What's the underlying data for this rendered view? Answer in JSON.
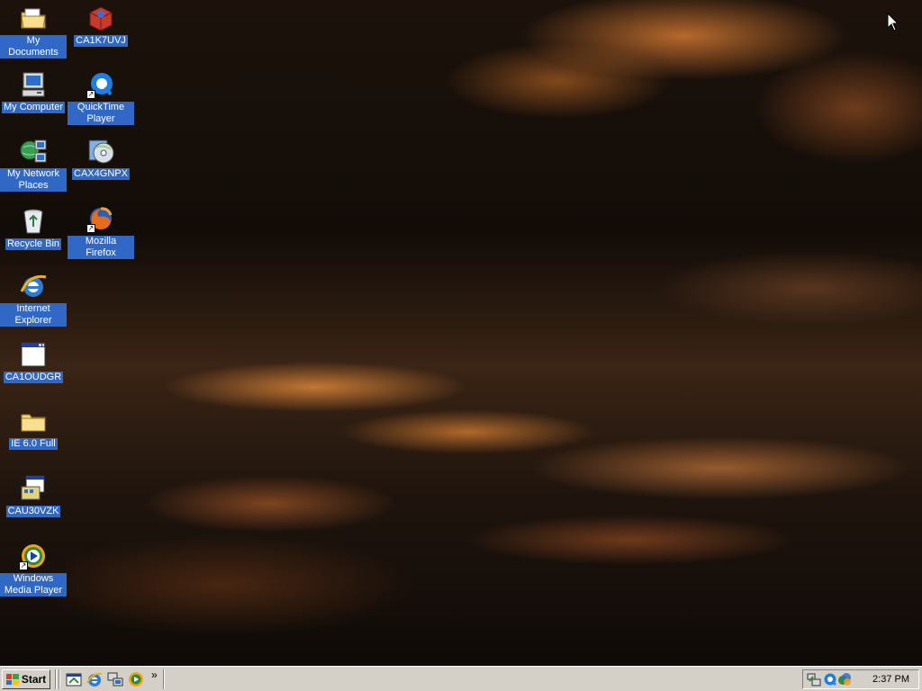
{
  "desktop": {
    "icons_col1": [
      {
        "label": "My Documents",
        "icon": "my-documents-icon"
      },
      {
        "label": "My Computer",
        "icon": "my-computer-icon"
      },
      {
        "label": "My Network Places",
        "icon": "network-places-icon"
      },
      {
        "label": "Recycle Bin",
        "icon": "recycle-bin-icon"
      },
      {
        "label": "Internet Explorer",
        "icon": "internet-explorer-icon"
      },
      {
        "label": "CA1OUDGR",
        "icon": "window-app-icon"
      },
      {
        "label": "IE 6.0 Full",
        "icon": "folder-icon"
      },
      {
        "label": "CAU30VZK",
        "icon": "installer-icon"
      },
      {
        "label": "Windows Media Player",
        "icon": "media-player-icon"
      }
    ],
    "icons_col2": [
      {
        "label": "CA1K7UVJ",
        "icon": "package-icon"
      },
      {
        "label": "QuickTime Player",
        "icon": "quicktime-icon"
      },
      {
        "label": "CAX4GNPX",
        "icon": "cd-installer-icon"
      },
      {
        "label": "Mozilla Firefox",
        "icon": "firefox-icon"
      }
    ]
  },
  "taskbar": {
    "start_label": "Start",
    "quick_launch": [
      "show-desktop-icon",
      "internet-explorer-icon",
      "network-icon",
      "media-player-icon"
    ],
    "overflow": "»",
    "tray_icons": [
      "network-tray-icon",
      "quicktime-tray-icon",
      "media-tray-icon"
    ],
    "clock": "2:37 PM"
  },
  "colors": {
    "selection": "#3168c6",
    "taskbar": "#d4d0c8"
  }
}
